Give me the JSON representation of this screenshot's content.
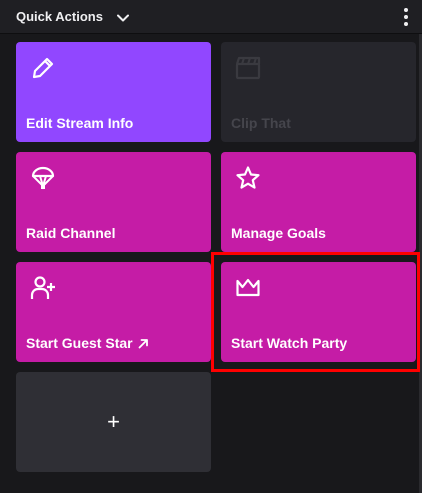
{
  "header": {
    "title": "Quick Actions",
    "chevron_icon": "chevron-down-icon",
    "more_icon": "more-vertical-icon"
  },
  "tiles": [
    {
      "label": "Edit Stream Info",
      "icon": "pencil-icon",
      "color": "#9147ff",
      "state": "enabled"
    },
    {
      "label": "Clip That",
      "icon": "clapperboard-icon",
      "color": "#26262c",
      "state": "disabled"
    },
    {
      "label": "Raid Channel",
      "icon": "parachute-icon",
      "color": "#c51ca6",
      "state": "enabled"
    },
    {
      "label": "Manage Goals",
      "icon": "star-icon",
      "color": "#c51ca6",
      "state": "enabled"
    },
    {
      "label": "Start Guest Star",
      "icon": "add-user-icon",
      "color": "#c51ca6",
      "state": "enabled",
      "trailing_icon": "external-arrow-icon"
    },
    {
      "label": "Start Watch Party",
      "icon": "crown-icon",
      "color": "#c51ca6",
      "state": "enabled",
      "highlighted": true
    }
  ],
  "add_tile": {
    "label": "+"
  },
  "colors": {
    "background": "#18181b",
    "accent_purple": "#9147ff",
    "accent_magenta": "#c51ca6",
    "highlight": "#ff0000"
  }
}
